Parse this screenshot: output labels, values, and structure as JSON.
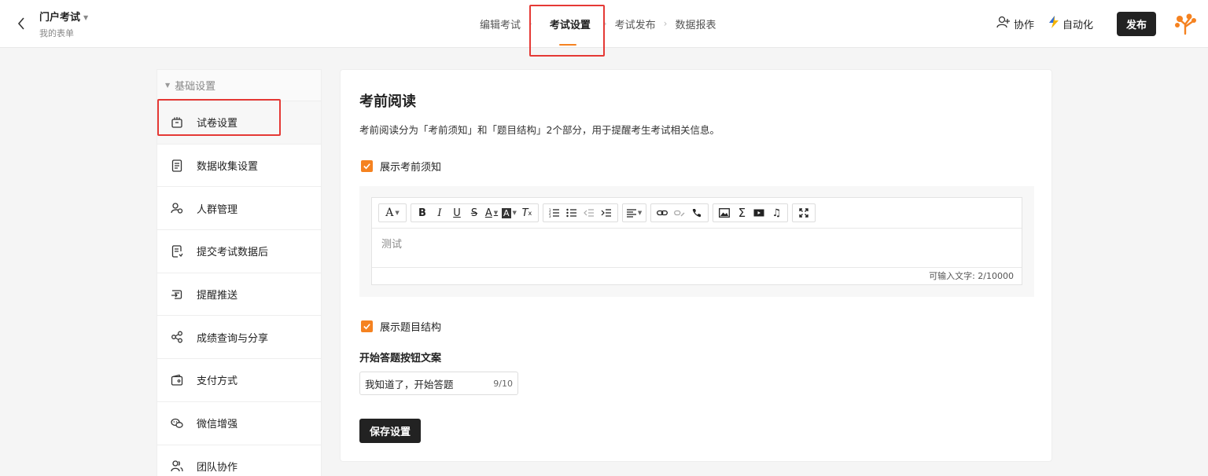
{
  "header": {
    "form_title": "门户考试",
    "form_subtitle": "我的表单",
    "steps": [
      "编辑考试",
      "考试设置",
      "考试发布",
      "数据报表"
    ],
    "active_step": 1,
    "collab_label": "协作",
    "automation_label": "自动化",
    "publish_label": "发布"
  },
  "sidebar": {
    "group_label": "基础设置",
    "items": [
      {
        "label": "试卷设置",
        "icon": "paper-settings-icon",
        "active": true
      },
      {
        "label": "数据收集设置",
        "icon": "document-icon"
      },
      {
        "label": "人群管理",
        "icon": "people-icon"
      },
      {
        "label": "提交考试数据后",
        "icon": "submit-doc-icon"
      },
      {
        "label": "提醒推送",
        "icon": "push-icon"
      },
      {
        "label": "成绩查询与分享",
        "icon": "share-icon"
      },
      {
        "label": "支付方式",
        "icon": "wallet-icon"
      },
      {
        "label": "微信增强",
        "icon": "wechat-icon"
      },
      {
        "label": "团队协作",
        "icon": "team-icon"
      }
    ]
  },
  "main": {
    "title": "考前阅读",
    "description": "考前阅读分为「考前须知」和「题目结构」2个部分，用于提醒考生考试相关信息。",
    "show_notice_label": "展示考前须知",
    "editor_content": "测试",
    "editor_counter": "可输入文字: 2/10000",
    "show_structure_label": "展示题目结构",
    "start_button_text_label": "开始答题按钮文案",
    "start_button_text_value": "我知道了，开始答题",
    "start_button_text_count": "9/10",
    "save_label": "保存设置"
  },
  "colors": {
    "accent": "#f58220",
    "highlight_box": "#e53935",
    "dark_button": "#222222"
  }
}
